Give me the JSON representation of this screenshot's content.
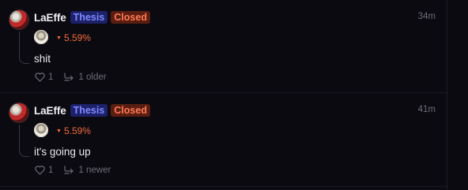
{
  "posts": [
    {
      "username": "LaEffe",
      "tags": [
        "Thesis",
        "Closed"
      ],
      "time": "34m",
      "avatar_icon": "user-avatar",
      "coin_icon": "token-avatar",
      "change": "5.59%",
      "change_direction": "down",
      "text": "shit",
      "likes": "1",
      "thread_link": "1 older"
    },
    {
      "username": "LaEffe",
      "tags": [
        "Thesis",
        "Closed"
      ],
      "time": "41m",
      "avatar_icon": "user-avatar",
      "coin_icon": "token-avatar",
      "change": "5.59%",
      "change_direction": "down",
      "text": "it's going up",
      "likes": "1",
      "thread_link": "1 newer"
    }
  ],
  "colors": {
    "background": "#0b0a10",
    "thesis_tag_bg": "#1c2169",
    "thesis_tag_text": "#7f8aff",
    "closed_tag_bg": "#5a1d11",
    "closed_tag_text": "#ff7a55",
    "negative_change": "#f26b3d",
    "muted_text": "#6e6b78"
  }
}
